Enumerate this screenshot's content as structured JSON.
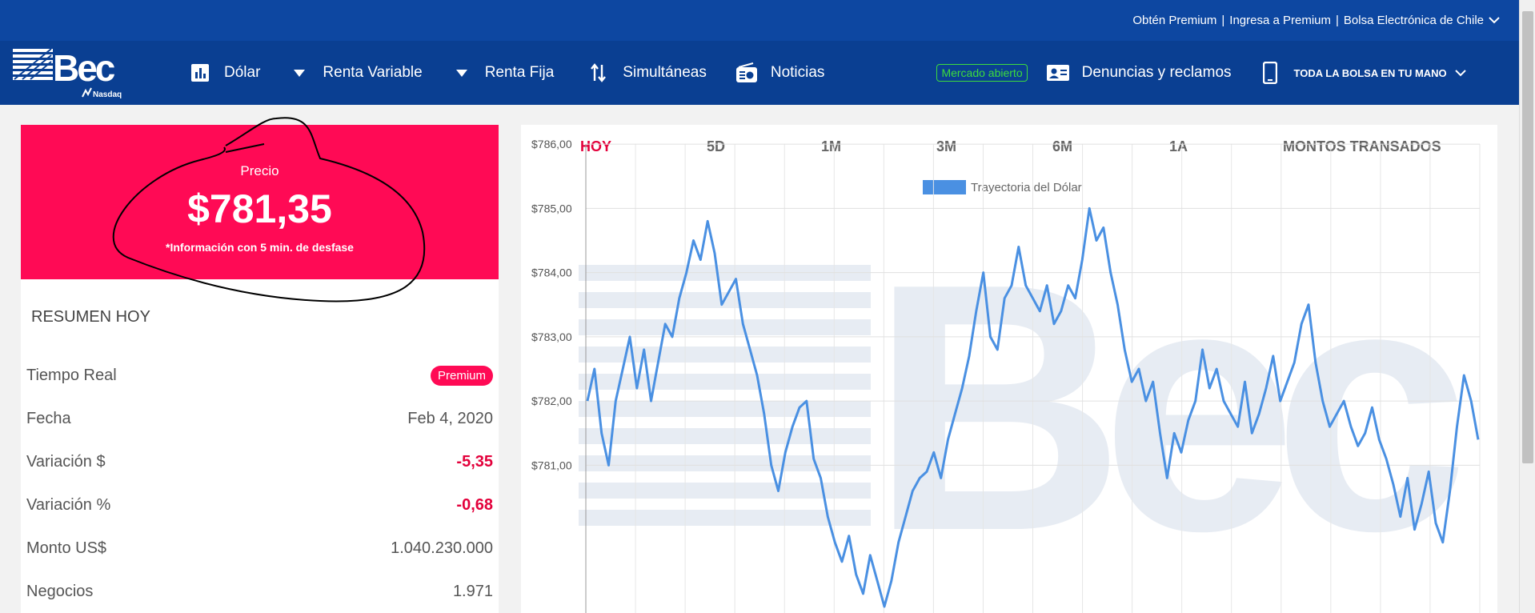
{
  "topbar": {
    "link1": "Obtén Premium",
    "link2": "Ingresa a Premium",
    "link3": "Bolsa Electrónica de Chile",
    "sep": "|"
  },
  "nav": {
    "logo_text": "Bec",
    "logo_sub": "Nasdaq",
    "items": [
      {
        "label": "Dólar"
      },
      {
        "label": "Renta Variable"
      },
      {
        "label": "Renta Fija"
      },
      {
        "label": "Simultáneas"
      },
      {
        "label": "Noticias"
      }
    ],
    "market_status": "Mercado abierto",
    "denuncias": "Denuncias y reclamos",
    "bolsa": "TODA LA BOLSA EN TU MANO"
  },
  "price": {
    "label": "Precio",
    "value": "$781,35",
    "note": "*Información con 5 min. de desfase"
  },
  "summary": {
    "title": "RESUMEN HOY",
    "rows": [
      {
        "label": "Tiempo Real",
        "value": "Premium"
      },
      {
        "label": "Fecha",
        "value": "Feb 4, 2020"
      },
      {
        "label": "Variación $",
        "value": "-5,35"
      },
      {
        "label": "Variación %",
        "value": "-0,68"
      },
      {
        "label": "Monto US$",
        "value": "1.040.230.000"
      },
      {
        "label": "Negocios",
        "value": "1.971"
      }
    ]
  },
  "tabs": [
    "HOY",
    "5D",
    "1M",
    "3M",
    "6M",
    "1A",
    "MONTOS TRANSADOS"
  ],
  "colors": {
    "accent": "#ff0a55",
    "navy": "#0a3f92",
    "line": "#4a90e2",
    "open": "#3ddc3d"
  },
  "chart_data": {
    "type": "line",
    "series": [
      {
        "name": "Trayectoria del Dólar",
        "values": [
          782.0,
          782.5,
          781.5,
          781.0,
          782.0,
          782.5,
          783.0,
          782.2,
          782.8,
          782.0,
          782.6,
          783.2,
          783.0,
          783.6,
          784.0,
          784.5,
          784.2,
          784.8,
          784.3,
          783.5,
          783.7,
          783.9,
          783.2,
          782.8,
          782.4,
          781.8,
          781.0,
          780.6,
          781.2,
          781.6,
          781.9,
          782.0,
          781.1,
          780.8,
          780.2,
          779.8,
          779.5,
          779.9,
          779.3,
          779.0,
          779.6,
          779.2,
          778.8,
          779.2,
          779.8,
          780.2,
          780.6,
          780.8,
          780.9,
          781.2,
          780.8,
          781.4,
          781.8,
          782.2,
          782.7,
          783.4,
          784.0,
          783.0,
          782.8,
          783.6,
          783.8,
          784.4,
          783.8,
          783.6,
          783.4,
          783.8,
          783.2,
          783.4,
          783.8,
          783.6,
          784.2,
          785.0,
          784.5,
          784.7,
          784.0,
          783.5,
          782.8,
          782.3,
          782.5,
          782.0,
          782.3,
          781.5,
          780.8,
          781.5,
          781.2,
          781.7,
          782.0,
          782.8,
          782.2,
          782.5,
          782.0,
          781.8,
          781.6,
          782.3,
          781.5,
          781.8,
          782.2,
          782.7,
          782.0,
          782.3,
          782.6,
          783.2,
          783.5,
          782.6,
          782.0,
          781.6,
          781.8,
          782.0,
          781.6,
          781.3,
          781.5,
          781.9,
          781.4,
          781.1,
          780.7,
          780.2,
          780.8,
          780.0,
          780.4,
          780.9,
          780.1,
          779.8,
          780.6,
          781.6,
          782.4,
          782.0,
          781.4
        ],
        "color": "#4a90e2"
      }
    ],
    "ylim": [
      778.7,
      786.3
    ],
    "yticks": [
      "$781,00",
      "$782,00",
      "$783,00",
      "$784,00",
      "$785,00",
      "$786,00"
    ],
    "ytick_values": [
      781,
      782,
      783,
      784,
      785,
      786
    ],
    "grid": true,
    "legend": "top-center"
  }
}
